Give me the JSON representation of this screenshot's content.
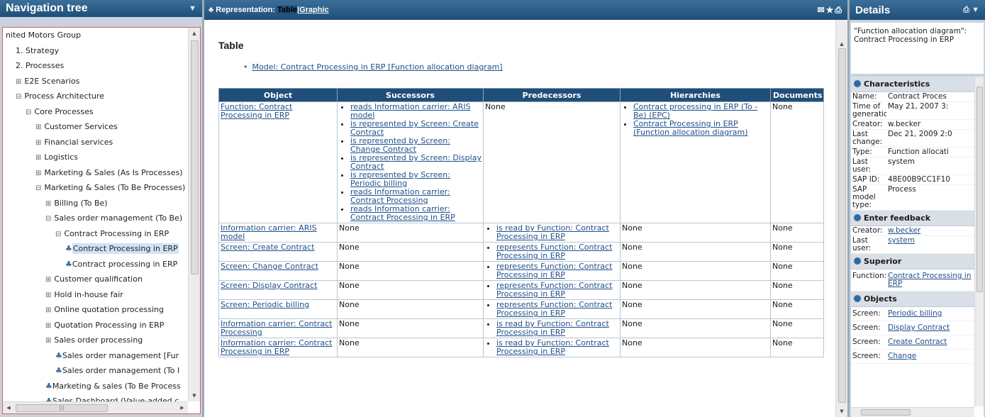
{
  "nav": {
    "title": "Navigation tree",
    "pin_icon": "pin-icon",
    "items": [
      {
        "label": "nited Motors Group",
        "indent": 0,
        "expander": "",
        "model": false
      },
      {
        "label": "1. Strategy",
        "indent": 1,
        "expander": "",
        "model": false
      },
      {
        "label": "2. Processes",
        "indent": 1,
        "expander": "",
        "model": false
      },
      {
        "label": "E2E Scenarios",
        "indent": 1,
        "expander": "⊞",
        "model": false
      },
      {
        "label": "Process Architecture",
        "indent": 1,
        "expander": "⊟",
        "model": false
      },
      {
        "label": "Core Processes",
        "indent": 2,
        "expander": "⊟",
        "model": false
      },
      {
        "label": "Customer Services",
        "indent": 3,
        "expander": "⊞",
        "model": false
      },
      {
        "label": "Financial services",
        "indent": 3,
        "expander": "⊞",
        "model": false
      },
      {
        "label": "Logistics",
        "indent": 3,
        "expander": "⊞",
        "model": false
      },
      {
        "label": "Marketing & Sales (As Is Processes)",
        "indent": 3,
        "expander": "⊞",
        "model": false
      },
      {
        "label": "Marketing & Sales (To Be Processes)",
        "indent": 3,
        "expander": "⊟",
        "model": false
      },
      {
        "label": "Billing (To Be)",
        "indent": 4,
        "expander": "⊞",
        "model": false
      },
      {
        "label": "Sales order management (To Be)",
        "indent": 4,
        "expander": "⊟",
        "model": false
      },
      {
        "label": "Contract Processing in ERP",
        "indent": 5,
        "expander": "⊟",
        "model": false
      },
      {
        "label": "Contract Processing in ERP",
        "indent": 6,
        "expander": "",
        "model": true,
        "selected": true
      },
      {
        "label": "Contract processing in ERP",
        "indent": 6,
        "expander": "",
        "model": true
      },
      {
        "label": "Customer qualification",
        "indent": 4,
        "expander": "⊞",
        "model": false
      },
      {
        "label": "Hold in-house fair",
        "indent": 4,
        "expander": "⊞",
        "model": false
      },
      {
        "label": "Online quotation processing",
        "indent": 4,
        "expander": "⊞",
        "model": false
      },
      {
        "label": "Quotation Processing in ERP",
        "indent": 4,
        "expander": "⊞",
        "model": false
      },
      {
        "label": "Sales order processing",
        "indent": 4,
        "expander": "⊞",
        "model": false
      },
      {
        "label": "Sales order management [Fur",
        "indent": 5,
        "expander": "",
        "model": true
      },
      {
        "label": "Sales order management (To I",
        "indent": 5,
        "expander": "",
        "model": true
      },
      {
        "label": "Marketing & sales (To Be Process",
        "indent": 4,
        "expander": "",
        "model": true
      },
      {
        "label": "Sales Dashboard (Value-added c",
        "indent": 4,
        "expander": "",
        "model": true
      }
    ]
  },
  "center": {
    "header_label": "Representation:",
    "mode_current": "Table",
    "mode_alt": "|Graphic",
    "icons": [
      "mail-icon",
      "star-icon",
      "print-icon"
    ],
    "title": "Table",
    "model_link": "Model: Contract Processing in ERP [Function allocation diagram]",
    "columns": [
      "Object",
      "Successors",
      "Predecessors",
      "Hierarchies",
      "Documents"
    ],
    "rows": [
      {
        "object": "Function: Contract Processing in ERP",
        "successors": [
          "reads Information carrier: ARIS model",
          "is represented by Screen: Create Contract",
          "is represented by Screen: Change Contract",
          "is represented by Screen: Display Contract",
          "is represented by Screen: Periodic billing",
          "reads Information carrier: Contract Processing",
          "reads Information carrier: Contract Processing in ERP"
        ],
        "predecessors_text": "None",
        "predecessors": [],
        "hierarchies": [
          "Contract processing in ERP (To -Be) (EPC)",
          "Contract Processing in ERP (Function allocation diagram)"
        ],
        "hierarchies_text": "",
        "documents": "None"
      },
      {
        "object": "Information carrier: ARIS model",
        "successors_text": "None",
        "successors": [],
        "predecessors": [
          "is read by Function: Contract Processing in ERP"
        ],
        "hierarchies_text": "None",
        "hierarchies": [],
        "documents": "None"
      },
      {
        "object": "Screen: Create Contract",
        "successors_text": "None",
        "successors": [],
        "predecessors": [
          "represents Function: Contract Processing in ERP"
        ],
        "hierarchies_text": "None",
        "hierarchies": [],
        "documents": "None"
      },
      {
        "object": "Screen: Change Contract",
        "successors_text": "None",
        "successors": [],
        "predecessors": [
          "represents Function: Contract Processing in ERP"
        ],
        "hierarchies_text": "None",
        "hierarchies": [],
        "documents": "None"
      },
      {
        "object": "Screen: Display Contract",
        "successors_text": "None",
        "successors": [],
        "predecessors": [
          "represents Function: Contract Processing in ERP"
        ],
        "hierarchies_text": "None",
        "hierarchies": [],
        "documents": "None"
      },
      {
        "object": "Screen: Periodic billing",
        "successors_text": "None",
        "successors": [],
        "predecessors": [
          "represents Function: Contract Processing in ERP"
        ],
        "hierarchies_text": "None",
        "hierarchies": [],
        "documents": "None"
      },
      {
        "object": "Information carrier: Contract Processing",
        "successors_text": "None",
        "successors": [],
        "predecessors": [
          "is read by Function: Contract Processing in ERP"
        ],
        "hierarchies_text": "None",
        "hierarchies": [],
        "documents": "None"
      },
      {
        "object": "Information carrier: Contract Processing in ERP",
        "successors_text": "None",
        "successors": [],
        "predecessors": [
          "is read by Function: Contract Processing in ERP"
        ],
        "hierarchies_text": "None",
        "hierarchies": [],
        "documents": "None"
      }
    ]
  },
  "details": {
    "title": "Details",
    "icons": [
      "print-icon",
      "pin-icon"
    ],
    "description": "\"Function allocation diagram\": Contract Processing in ERP",
    "characteristics_title": "Characteristics",
    "characteristics": [
      {
        "k": "Name:",
        "v": "Contract Proces"
      },
      {
        "k": "Time of generation:",
        "v": "May 21, 2007 3:"
      },
      {
        "k": "Creator:",
        "v": "w.becker"
      },
      {
        "k": "Last change:",
        "v": "Dec 21, 2009 2:0"
      },
      {
        "k": "Type:",
        "v": "Function allocati"
      },
      {
        "k": "Last user:",
        "v": "system"
      },
      {
        "k": "SAP ID:",
        "v": "48E00B9CC1F10"
      },
      {
        "k": "SAP model type:",
        "v": "Process"
      }
    ],
    "feedback_title": "Enter feedback",
    "feedback": [
      {
        "k": "Creator:",
        "v": "w.becker"
      },
      {
        "k": "Last user:",
        "v": "system"
      }
    ],
    "superior_title": "Superior",
    "superior": [
      {
        "k": "Function:",
        "v": "Contract Processing in ERP"
      }
    ],
    "objects_title": "Objects",
    "objects": [
      {
        "k": "Screen:",
        "v": "Periodic billing"
      },
      {
        "k": "Screen:",
        "v": "Display Contract"
      },
      {
        "k": "Screen:",
        "v": "Create Contract"
      },
      {
        "k": "Screen:",
        "v": "Change"
      }
    ]
  }
}
